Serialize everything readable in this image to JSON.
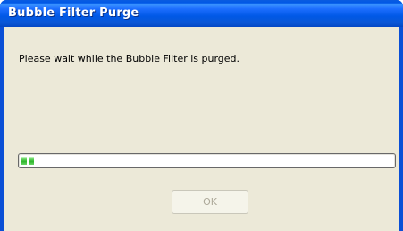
{
  "window": {
    "title": "Bubble Filter Purge"
  },
  "dialog": {
    "message": "Please wait while the Bubble Filter is purged.",
    "progress": {
      "value_percent": 3,
      "color": "#2db52a"
    },
    "ok_button": {
      "label": "OK",
      "enabled": false
    }
  },
  "colors": {
    "titlebar": "#0058e6",
    "client_background": "#ece9d8"
  }
}
